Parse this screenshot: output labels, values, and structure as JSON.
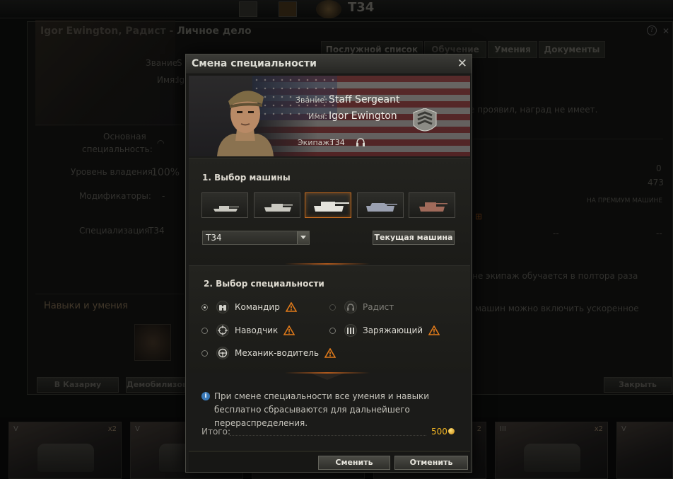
{
  "background": {
    "tank_title": "T34",
    "window_title": "Igor Ewington, Радист - Личное дело",
    "rank_label": "Звание:",
    "rank_value_cut": "S",
    "name_label": "Имя:",
    "name_value_cut": "Ig",
    "main_spec_label_1": "Основная",
    "main_spec_label_2": "специальность:",
    "mastery_label": "Уровень владения:",
    "mastery_value": "100%",
    "modifiers_label": "Модификаторы:",
    "modifiers_value": "-",
    "specialization_label": "Специализация:",
    "specialization_value": "T34",
    "skills_label": "Навыки и умения",
    "tabs": [
      "Послужной список",
      "Обучение",
      "Умения",
      "Документы"
    ],
    "record_text": "е проявил, наград не имеет.",
    "stat_1": "0",
    "stat_2": "473",
    "premium_text": "НА ПРЕМИУМ МАШИНЕ",
    "dash_1": "--",
    "dash_2": "--",
    "line_1": "не экипаж обучается в полтора раза",
    "line_2": "машин можно включить ускоренное",
    "btn_barracks": "В Казарму",
    "btn_demob": "Демобилизов",
    "btn_close": "Закрыть",
    "carousel": [
      {
        "tier": "V",
        "mult": "x2"
      },
      {
        "tier": "V",
        "mult": ""
      },
      {
        "tier": "",
        "mult": ""
      },
      {
        "tier": "",
        "mult": "2"
      },
      {
        "tier": "III",
        "mult": "x2"
      },
      {
        "tier": "V",
        "mult": ""
      }
    ]
  },
  "dialog": {
    "title": "Смена специальности",
    "rank_label": "Звание:",
    "rank_value": "Staff Sergeant",
    "name_label": "Имя:",
    "name_value": "Igor Ewington",
    "crew_label": "Экипаж:",
    "crew_value": "T34",
    "section1_title": "1. Выбор машины",
    "vehicles": [
      "tank-1",
      "tank-2",
      "tank-3-selected",
      "tank-4",
      "tank-5"
    ],
    "selected_vehicle": "T34",
    "current_vehicle_button": "Текущая машина",
    "section2_title": "2. Выбор специальности",
    "roles": [
      {
        "label": "Командир",
        "icon": "binoculars-icon",
        "warn": true,
        "selected": true,
        "disabled": false
      },
      {
        "label": "Радист",
        "icon": "headphones-icon",
        "warn": false,
        "selected": false,
        "disabled": true
      },
      {
        "label": "Наводчик",
        "icon": "crosshair-icon",
        "warn": true,
        "selected": false,
        "disabled": false
      },
      {
        "label": "Заряжающий",
        "icon": "shells-icon",
        "warn": true,
        "selected": false,
        "disabled": false
      },
      {
        "label": "Механик-водитель",
        "icon": "steering-wheel-icon",
        "warn": true,
        "selected": false,
        "disabled": false
      }
    ],
    "info_text": "При смене специальности все умения и навыки бесплатно сбрасываются для дальнейшего перераспределения.",
    "total_label": "Итого:",
    "total_value": "500",
    "change_button": "Сменить",
    "cancel_button": "Отменить"
  },
  "colors": {
    "accent_orange": "#c36a1e",
    "gold": "#f0b422",
    "warning": "#e07a1a",
    "info_blue": "#3a7ab8"
  }
}
